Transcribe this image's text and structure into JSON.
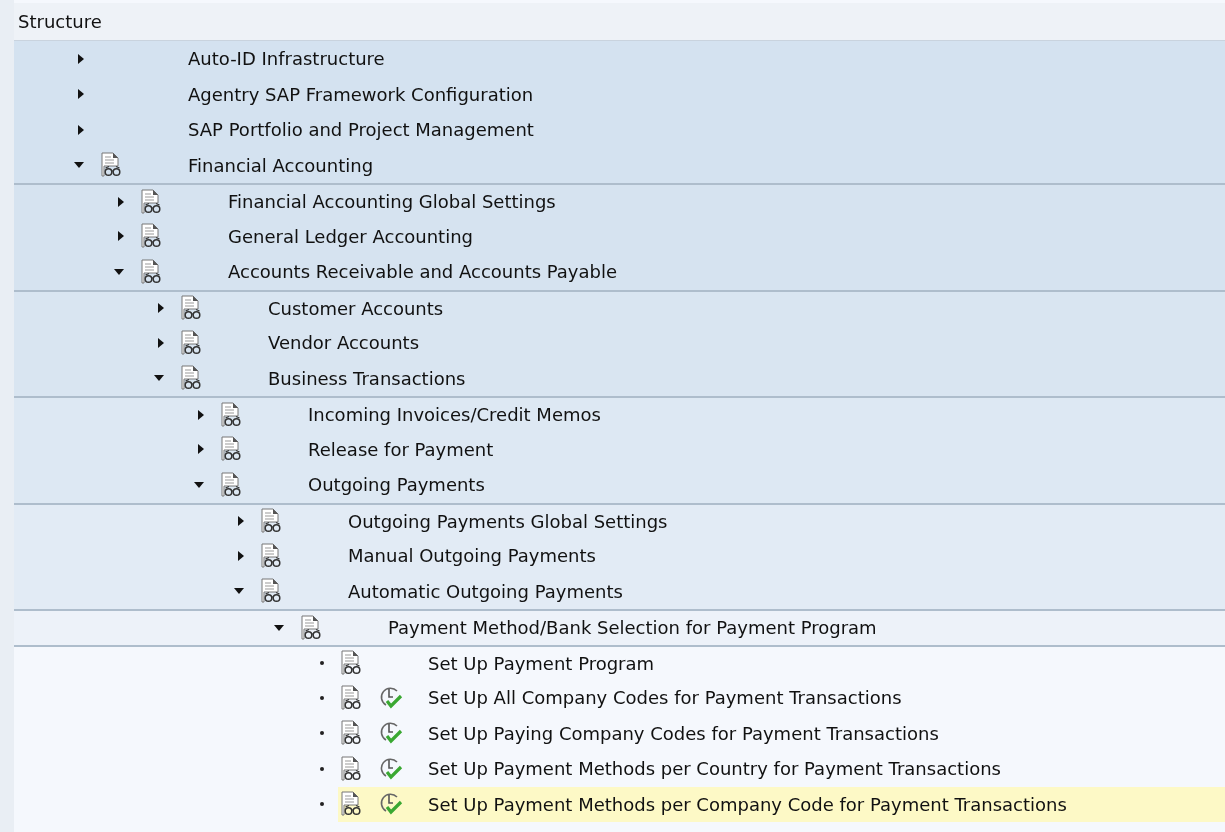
{
  "header": "Structure",
  "tree": [
    {
      "label": "Auto-ID Infrastructure",
      "kind": "node",
      "expanded": false,
      "doc_icon": false,
      "activity_icon": false,
      "selected": false
    },
    {
      "label": "Agentry SAP Framework Configuration",
      "kind": "node",
      "expanded": false,
      "doc_icon": false,
      "activity_icon": false,
      "selected": false
    },
    {
      "label": "SAP Portfolio and Project Management",
      "kind": "node",
      "expanded": false,
      "doc_icon": false,
      "activity_icon": false,
      "selected": false
    },
    {
      "label": "Financial Accounting",
      "kind": "node",
      "expanded": true,
      "doc_icon": true,
      "activity_icon": false,
      "selected": false,
      "children": [
        {
          "label": "Financial Accounting Global Settings",
          "kind": "node",
          "expanded": false,
          "doc_icon": true,
          "activity_icon": false,
          "selected": false
        },
        {
          "label": "General Ledger Accounting",
          "kind": "node",
          "expanded": false,
          "doc_icon": true,
          "activity_icon": false,
          "selected": false
        },
        {
          "label": "Accounts Receivable and Accounts Payable",
          "kind": "node",
          "expanded": true,
          "doc_icon": true,
          "activity_icon": false,
          "selected": false,
          "children": [
            {
              "label": "Customer Accounts",
              "kind": "node",
              "expanded": false,
              "doc_icon": true,
              "activity_icon": false,
              "selected": false
            },
            {
              "label": "Vendor Accounts",
              "kind": "node",
              "expanded": false,
              "doc_icon": true,
              "activity_icon": false,
              "selected": false
            },
            {
              "label": "Business Transactions",
              "kind": "node",
              "expanded": true,
              "doc_icon": true,
              "activity_icon": false,
              "selected": false,
              "children": [
                {
                  "label": "Incoming Invoices/Credit Memos",
                  "kind": "node",
                  "expanded": false,
                  "doc_icon": true,
                  "activity_icon": false,
                  "selected": false
                },
                {
                  "label": "Release for Payment",
                  "kind": "node",
                  "expanded": false,
                  "doc_icon": true,
                  "activity_icon": false,
                  "selected": false
                },
                {
                  "label": "Outgoing Payments",
                  "kind": "node",
                  "expanded": true,
                  "doc_icon": true,
                  "activity_icon": false,
                  "selected": false,
                  "children": [
                    {
                      "label": "Outgoing Payments Global Settings",
                      "kind": "node",
                      "expanded": false,
                      "doc_icon": true,
                      "activity_icon": false,
                      "selected": false
                    },
                    {
                      "label": "Manual Outgoing Payments",
                      "kind": "node",
                      "expanded": false,
                      "doc_icon": true,
                      "activity_icon": false,
                      "selected": false
                    },
                    {
                      "label": "Automatic Outgoing Payments",
                      "kind": "node",
                      "expanded": true,
                      "doc_icon": true,
                      "activity_icon": false,
                      "selected": false,
                      "children": [
                        {
                          "label": "Payment Method/Bank Selection for Payment Program",
                          "kind": "node",
                          "expanded": true,
                          "doc_icon": true,
                          "activity_icon": false,
                          "selected": false,
                          "children": [
                            {
                              "label": "Set Up Payment Program",
                              "kind": "leaf",
                              "doc_icon": true,
                              "activity_icon": false,
                              "selected": false
                            },
                            {
                              "label": "Set Up All Company Codes for Payment Transactions",
                              "kind": "leaf",
                              "doc_icon": true,
                              "activity_icon": true,
                              "selected": false
                            },
                            {
                              "label": "Set Up Paying Company Codes for Payment Transactions",
                              "kind": "leaf",
                              "doc_icon": true,
                              "activity_icon": true,
                              "selected": false
                            },
                            {
                              "label": "Set Up Payment Methods per Country for Payment Transactions",
                              "kind": "leaf",
                              "doc_icon": true,
                              "activity_icon": true,
                              "selected": false
                            },
                            {
                              "label": "Set Up Payment Methods per Company Code for Payment Transactions",
                              "kind": "leaf",
                              "doc_icon": true,
                              "activity_icon": true,
                              "selected": true
                            }
                          ]
                        }
                      ]
                    }
                  ]
                }
              ]
            }
          ]
        }
      ]
    }
  ]
}
